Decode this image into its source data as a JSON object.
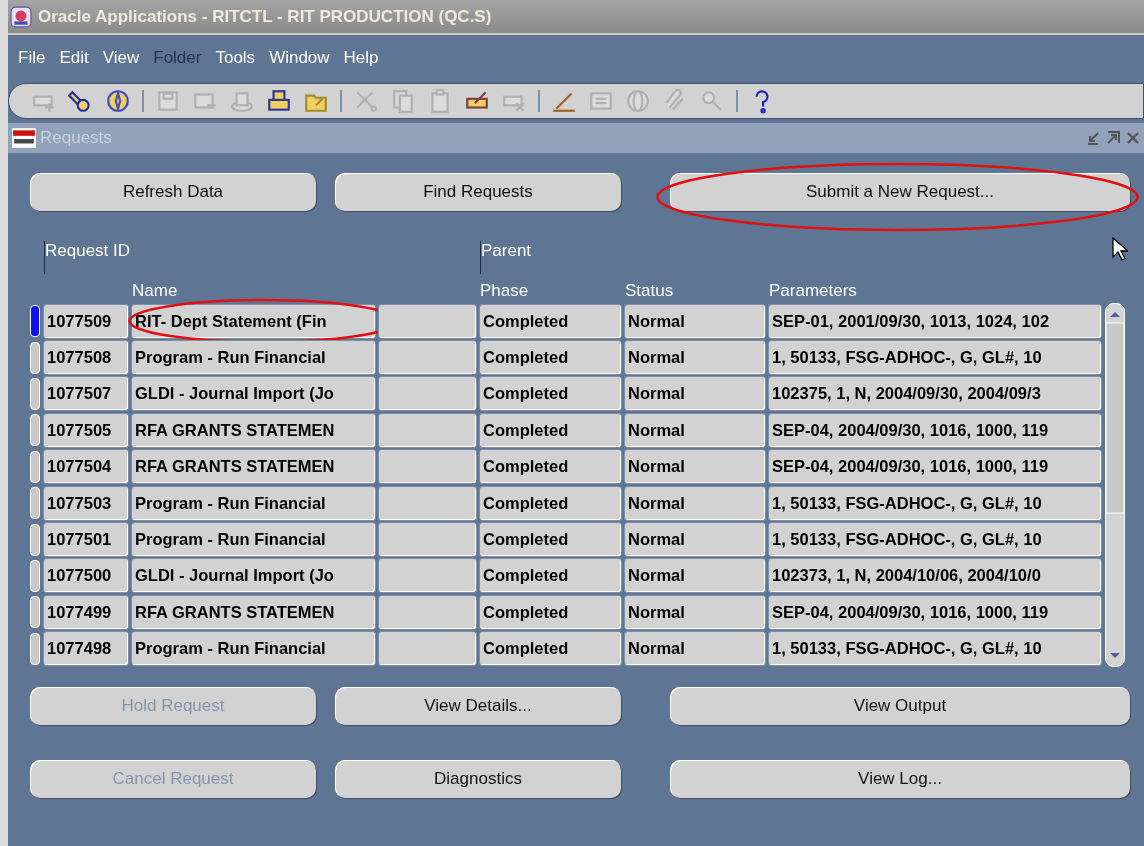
{
  "window": {
    "title": "Oracle Applications - RITCTL - RIT PRODUCTION (QC.S)"
  },
  "menu": [
    {
      "label": "File",
      "disabled": false
    },
    {
      "label": "Edit",
      "disabled": false
    },
    {
      "label": "View",
      "disabled": false
    },
    {
      "label": "Folder",
      "disabled": true
    },
    {
      "label": "Tools",
      "disabled": false
    },
    {
      "label": "Window",
      "disabled": false
    },
    {
      "label": "Help",
      "disabled": false
    }
  ],
  "toolbar": [
    {
      "kind": "new",
      "disabled": true
    },
    {
      "kind": "find",
      "disabled": false
    },
    {
      "kind": "navigator",
      "disabled": false
    },
    {
      "kind": "separator"
    },
    {
      "kind": "save",
      "disabled": true
    },
    {
      "kind": "next",
      "disabled": true
    },
    {
      "kind": "switch",
      "disabled": true
    },
    {
      "kind": "print",
      "disabled": false
    },
    {
      "kind": "close",
      "disabled": false
    },
    {
      "kind": "separator"
    },
    {
      "kind": "cut",
      "disabled": true
    },
    {
      "kind": "copy",
      "disabled": true
    },
    {
      "kind": "paste",
      "disabled": true
    },
    {
      "kind": "clear",
      "disabled": false
    },
    {
      "kind": "delete",
      "disabled": true
    },
    {
      "kind": "separator"
    },
    {
      "kind": "edit",
      "disabled": false
    },
    {
      "kind": "zoom",
      "disabled": true
    },
    {
      "kind": "translate",
      "disabled": true
    },
    {
      "kind": "attach",
      "disabled": true
    },
    {
      "kind": "folder",
      "disabled": true
    },
    {
      "kind": "separator"
    },
    {
      "kind": "help",
      "disabled": false
    }
  ],
  "form": {
    "title": "Requests",
    "top_buttons": [
      {
        "label": "Refresh Data",
        "disabled": false,
        "circled": false
      },
      {
        "label": "Find Requests",
        "disabled": false,
        "circled": false
      },
      {
        "label": "Submit a New Request...",
        "disabled": false,
        "circled": true
      }
    ],
    "columns": {
      "request_id": "Request ID",
      "parent": "Parent",
      "name": "Name",
      "phase": "Phase",
      "status": "Status",
      "parameters": "Parameters"
    },
    "rows": [
      {
        "id": "1077509",
        "name": "RIT- Dept Statement (Fin",
        "parent": "",
        "phase": "Completed",
        "status": "Normal",
        "parameters": "SEP-01, 2001/09/30, 1013, 1024, 102",
        "selected": true,
        "circled": true
      },
      {
        "id": "1077508",
        "name": "Program - Run Financial",
        "parent": "",
        "phase": "Completed",
        "status": "Normal",
        "parameters": "1, 50133, FSG-ADHOC-, G, GL#, 10",
        "selected": false,
        "circled": false
      },
      {
        "id": "1077507",
        "name": "GLDI - Journal Import (Jo",
        "parent": "",
        "phase": "Completed",
        "status": "Normal",
        "parameters": "102375, 1, N, 2004/09/30, 2004/09/3",
        "selected": false,
        "circled": false
      },
      {
        "id": "1077505",
        "name": "RFA GRANTS STATEMEN",
        "parent": "",
        "phase": "Completed",
        "status": "Normal",
        "parameters": "SEP-04, 2004/09/30, 1016, 1000, 119",
        "selected": false,
        "circled": false
      },
      {
        "id": "1077504",
        "name": "RFA GRANTS STATEMEN",
        "parent": "",
        "phase": "Completed",
        "status": "Normal",
        "parameters": "SEP-04, 2004/09/30, 1016, 1000, 119",
        "selected": false,
        "circled": false
      },
      {
        "id": "1077503",
        "name": "Program - Run Financial",
        "parent": "",
        "phase": "Completed",
        "status": "Normal",
        "parameters": "1, 50133, FSG-ADHOC-, G, GL#, 10",
        "selected": false,
        "circled": false
      },
      {
        "id": "1077501",
        "name": "Program - Run Financial",
        "parent": "",
        "phase": "Completed",
        "status": "Normal",
        "parameters": "1, 50133, FSG-ADHOC-, G, GL#, 10",
        "selected": false,
        "circled": false
      },
      {
        "id": "1077500",
        "name": "GLDI - Journal Import (Jo",
        "parent": "",
        "phase": "Completed",
        "status": "Normal",
        "parameters": "102373, 1, N, 2004/10/06, 2004/10/0",
        "selected": false,
        "circled": false
      },
      {
        "id": "1077499",
        "name": "RFA GRANTS STATEMEN",
        "parent": "",
        "phase": "Completed",
        "status": "Normal",
        "parameters": "SEP-04, 2004/09/30, 1016, 1000, 119",
        "selected": false,
        "circled": false
      },
      {
        "id": "1077498",
        "name": "Program - Run Financial",
        "parent": "",
        "phase": "Completed",
        "status": "Normal",
        "parameters": "1, 50133, FSG-ADHOC-, G, GL#, 10",
        "selected": false,
        "circled": false
      }
    ],
    "bottom_buttons": [
      {
        "label": "Hold Request",
        "disabled": true,
        "circled": false
      },
      {
        "label": "View Details...",
        "disabled": false,
        "circled": false
      },
      {
        "label": "View Output",
        "disabled": false,
        "circled": false
      },
      {
        "label": "Cancel Request",
        "disabled": true,
        "circled": false
      },
      {
        "label": "Diagnostics",
        "disabled": false,
        "circled": false
      },
      {
        "label": "View Log...",
        "disabled": false,
        "circled": false
      }
    ]
  }
}
